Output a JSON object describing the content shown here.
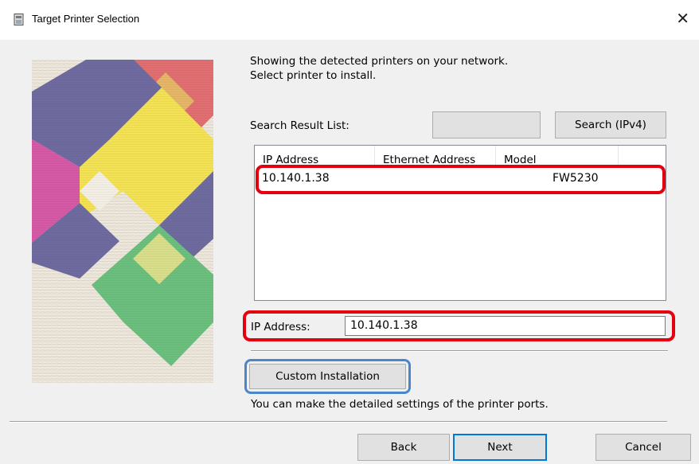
{
  "window": {
    "title": "Target Printer Selection",
    "close_glyph": "✕",
    "icon": "printer-app-icon"
  },
  "description": {
    "line1": "Showing the detected printers on your network.",
    "line2": "Select printer to install."
  },
  "search": {
    "label": "Search Result List:",
    "blank_button_label": "",
    "search_button_label": "Search (IPv4)"
  },
  "results": {
    "columns": [
      "IP Address",
      "Ethernet Address",
      "Model",
      ""
    ],
    "rows": [
      {
        "ip": "10.140.1.38",
        "ethernet": "",
        "model": "FW5230"
      }
    ]
  },
  "ip_address": {
    "label": "IP Address:",
    "value": "10.140.1.38"
  },
  "custom_installation": {
    "button_label": "Custom Installation",
    "note": "You can make the detailed settings of the printer ports."
  },
  "footer": {
    "back_label": "Back",
    "next_label": "Next",
    "cancel_label": "Cancel"
  },
  "colors": {
    "highlight_red": "#e3000f",
    "highlight_blue": "#4a86c8",
    "focus_blue": "#0078d7"
  }
}
